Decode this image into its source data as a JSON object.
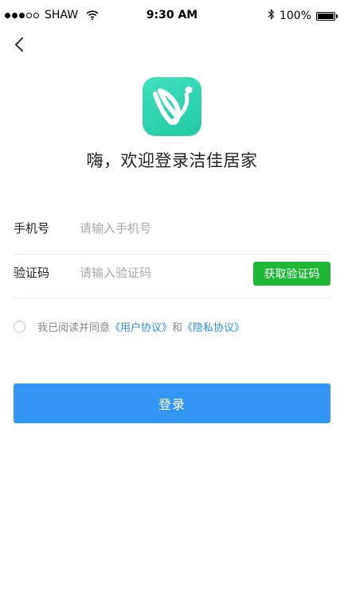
{
  "status_bar": {
    "carrier": "SHAW",
    "time": "9:30 AM",
    "battery": "100%",
    "icons": [
      "signal-dots",
      "wifi-icon",
      "bluetooth-icon",
      "battery-icon"
    ]
  },
  "header": {
    "back_icon": "chevron-left-icon"
  },
  "brand": {
    "logo_icon": "app-logo",
    "welcome": "嗨，欢迎登录洁佳居家",
    "colors": {
      "logo_start": "#3fe0c0",
      "logo_end": "#22c9a4"
    }
  },
  "form": {
    "phone": {
      "label": "手机号",
      "placeholder": "请输入手机号",
      "value": ""
    },
    "code": {
      "label": "验证码",
      "placeholder": "请输入验证码",
      "value": "",
      "button": "获取验证码"
    }
  },
  "agreement": {
    "prefix": "我已阅读并同意",
    "user_agreement": "《用户协议》",
    "conjunction": "和",
    "privacy_policy": "《隐私协议》",
    "checked": false
  },
  "login": {
    "label": "登录"
  },
  "colors": {
    "code_button": "#1fb834",
    "login_button": "#3396f5",
    "link": "#2e8fe6"
  }
}
